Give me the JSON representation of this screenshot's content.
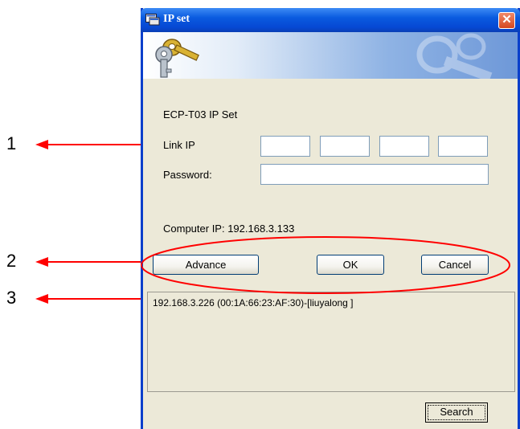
{
  "window": {
    "title": "IP set",
    "close_label": "✕"
  },
  "form": {
    "heading": "ECP-T03 IP Set",
    "link_ip_label": "Link IP",
    "link_ip_octets": [
      "",
      "",
      "",
      ""
    ],
    "password_label": "Password:",
    "password_value": "",
    "computer_ip_text": "Computer IP: 192.168.3.133"
  },
  "buttons": {
    "advance": "Advance",
    "ok": "OK",
    "cancel": "Cancel",
    "search": "Search"
  },
  "device_list": {
    "items": [
      "192.168.3.226 (00:1A:66:23:AF:30)-[liuyalong ]"
    ]
  },
  "callouts": [
    "1",
    "2",
    "3"
  ],
  "colors": {
    "arrow": "#FF0000",
    "title_bar": "#0A5BE0",
    "dialog_bg": "#ECE9D8"
  },
  "icons": [
    "keys-icon",
    "close-icon"
  ]
}
